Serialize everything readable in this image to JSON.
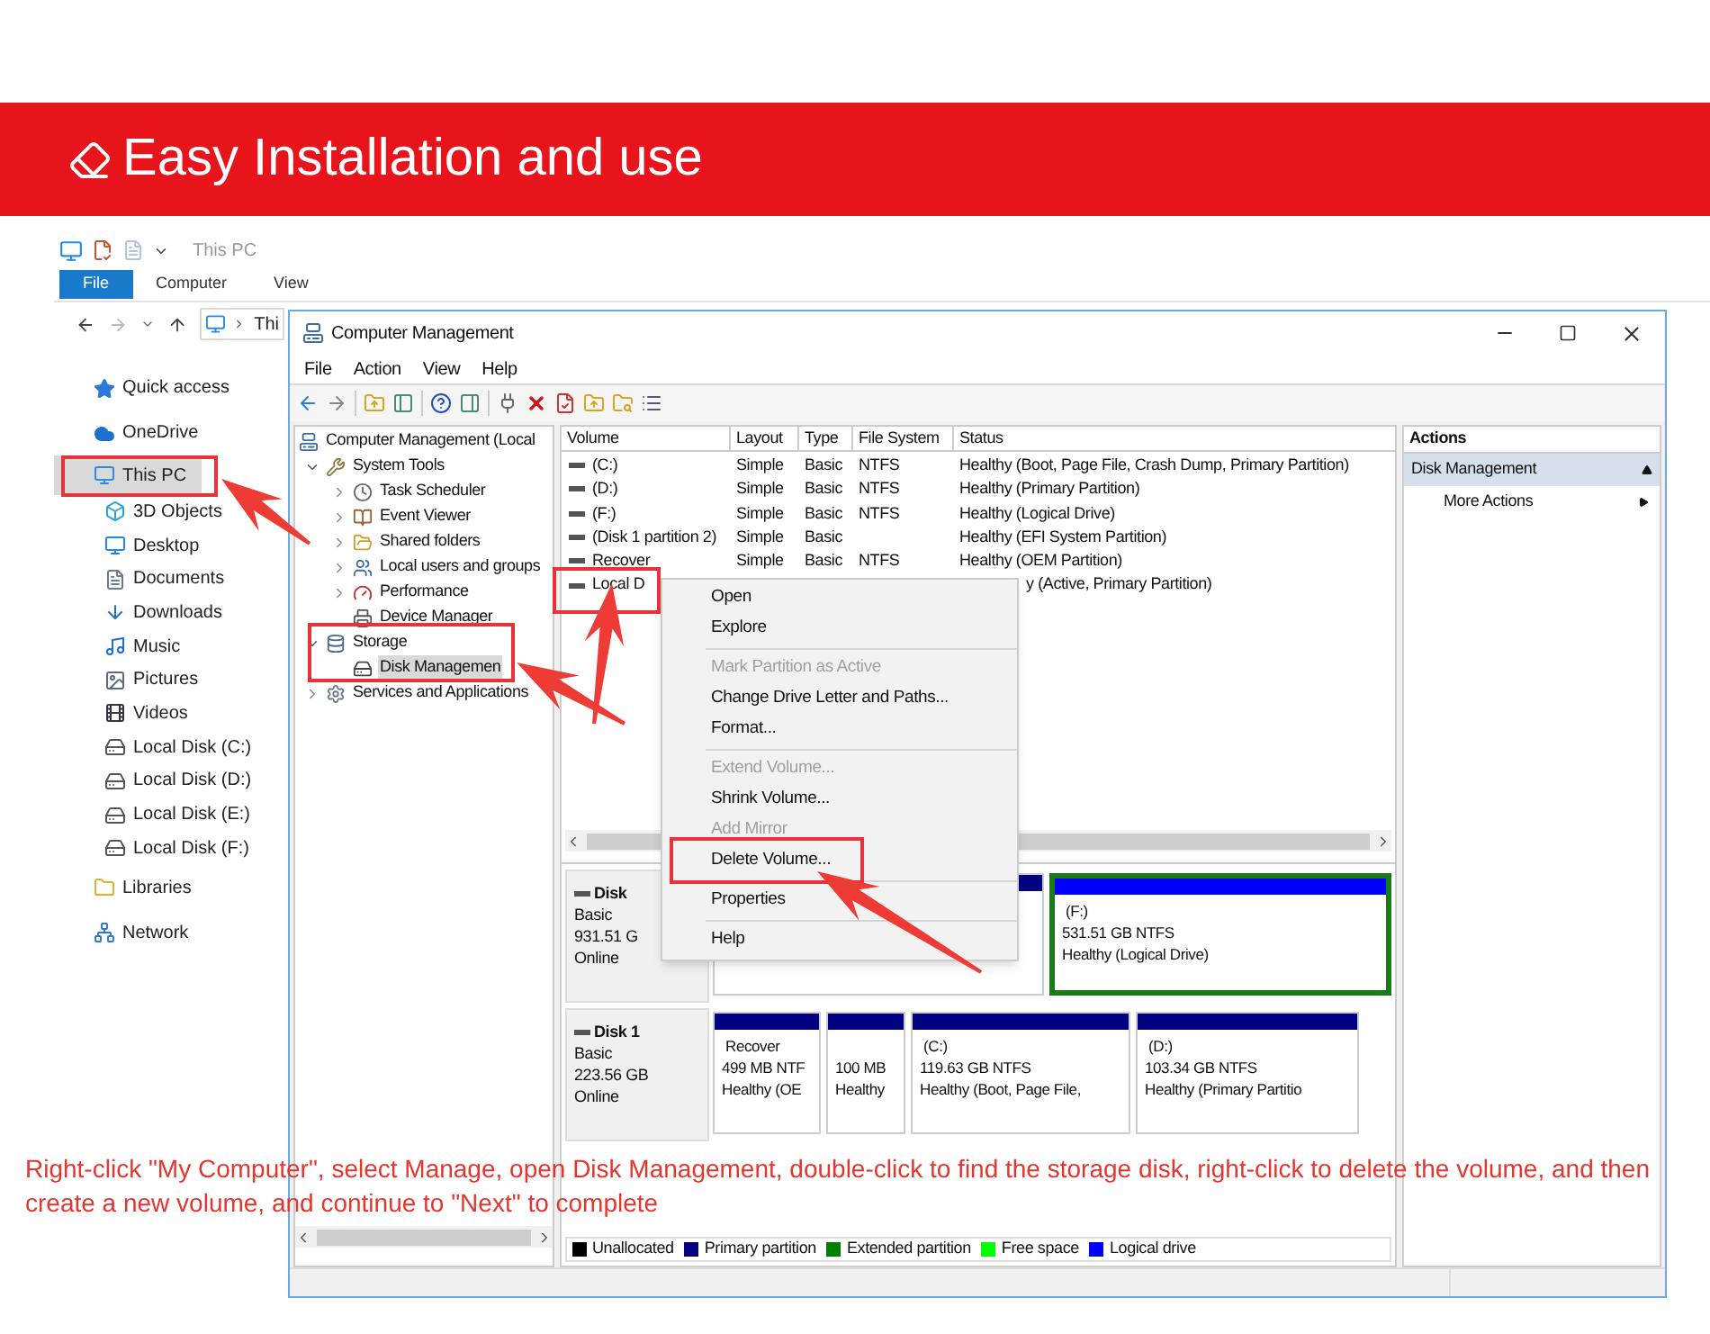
{
  "banner": {
    "title": "Easy Installation and use"
  },
  "explorer": {
    "title": "This PC",
    "ribbon_tabs": [
      {
        "label": "File",
        "selected": true
      },
      {
        "label": "Computer",
        "selected": false
      },
      {
        "label": "View",
        "selected": false
      }
    ],
    "address": "Thi",
    "nav": [
      {
        "label": "Quick access",
        "kind": "star",
        "selected": false
      },
      {
        "label": "OneDrive",
        "kind": "cloud",
        "selected": false
      },
      {
        "label": "This PC",
        "kind": "pc",
        "selected": true,
        "children": [
          {
            "label": "3D Objects",
            "kind": "cube",
            "selected": false
          },
          {
            "label": "Desktop",
            "kind": "desktop",
            "selected": false
          },
          {
            "label": "Documents",
            "kind": "document",
            "selected": false
          },
          {
            "label": "Downloads",
            "kind": "download",
            "selected": false
          },
          {
            "label": "Music",
            "kind": "music",
            "selected": false
          },
          {
            "label": "Pictures",
            "kind": "pictures",
            "selected": false
          },
          {
            "label": "Videos",
            "kind": "videos",
            "selected": false
          },
          {
            "label": "Local Disk (C:)",
            "kind": "disk",
            "selected": false
          },
          {
            "label": "Local Disk (D:)",
            "kind": "disk",
            "selected": false
          },
          {
            "label": "Local Disk (E:)",
            "kind": "disk",
            "selected": false
          },
          {
            "label": "Local Disk (F:)",
            "kind": "disk",
            "selected": false
          }
        ]
      },
      {
        "label": "Libraries",
        "kind": "library",
        "selected": false
      },
      {
        "label": "Network",
        "kind": "network",
        "selected": false
      }
    ]
  },
  "manager": {
    "title": "Computer Management",
    "menu": [
      "File",
      "Action",
      "View",
      "Help"
    ],
    "tree": [
      {
        "label": "Computer Management (Local",
        "kind": "computer",
        "selected": false,
        "children": [
          {
            "label": "System Tools",
            "kind": "tools",
            "expanded": true,
            "selected": false,
            "children": [
              {
                "label": "Task Scheduler",
                "kind": "clock",
                "expanded": false,
                "selected": false
              },
              {
                "label": "Event Viewer",
                "kind": "event",
                "expanded": false,
                "selected": false
              },
              {
                "label": "Shared folders",
                "kind": "shared",
                "expanded": false,
                "selected": false
              },
              {
                "label": "Local users and groups",
                "kind": "users",
                "expanded": false,
                "selected": false
              },
              {
                "label": "Performance",
                "kind": "performance",
                "expanded": false,
                "selected": false
              },
              {
                "label": "Device Manager",
                "kind": "device",
                "selected": false
              }
            ]
          },
          {
            "label": "Storage",
            "kind": "storage",
            "expanded": true,
            "selected": false,
            "children": [
              {
                "label": "Disk Managemen",
                "kind": "disk",
                "selected": true
              }
            ]
          },
          {
            "label": "Services and Applications",
            "kind": "services",
            "expanded": false,
            "selected": false
          }
        ]
      }
    ],
    "columns": [
      "Volume",
      "Layout",
      "Type",
      "File System",
      "Status"
    ],
    "rows": [
      {
        "volume": "(C:)",
        "layout": "Simple",
        "type": "Basic",
        "file_system": "NTFS",
        "status": "Healthy (Boot, Page File, Crash Dump, Primary Partition)"
      },
      {
        "volume": "(D:)",
        "layout": "Simple",
        "type": "Basic",
        "file_system": "NTFS",
        "status": "Healthy (Primary Partition)"
      },
      {
        "volume": "(F:)",
        "layout": "Simple",
        "type": "Basic",
        "file_system": "NTFS",
        "status": "Healthy (Logical Drive)"
      },
      {
        "volume": "(Disk 1 partition 2)",
        "layout": "Simple",
        "type": "Basic",
        "status": "Healthy (EFI System Partition)"
      },
      {
        "volume": "Recover",
        "layout": "Simple",
        "type": "Basic",
        "file_system": "NTFS",
        "status": "Healthy (OEM Partition)"
      },
      {
        "volume": "Local D",
        "status": "y (Active, Primary Partition)"
      }
    ],
    "context_menu": [
      {
        "kind": "item",
        "label": "Open",
        "disabled": false
      },
      {
        "kind": "item",
        "label": "Explore",
        "disabled": false
      },
      {
        "kind": "separator"
      },
      {
        "kind": "item",
        "label": "Mark Partition as Active",
        "disabled": true
      },
      {
        "kind": "item",
        "label": "Change Drive Letter and Paths...",
        "disabled": false
      },
      {
        "kind": "item",
        "label": "Format...",
        "disabled": false
      },
      {
        "kind": "separator"
      },
      {
        "kind": "item",
        "label": "Extend Volume...",
        "disabled": true
      },
      {
        "kind": "item",
        "label": "Shrink Volume...",
        "disabled": false
      },
      {
        "kind": "item",
        "label": "Add Mirror",
        "disabled": true
      },
      {
        "kind": "item",
        "label": "Delete Volume...",
        "disabled": false
      },
      {
        "kind": "separator"
      },
      {
        "kind": "item",
        "label": "Properties",
        "disabled": false
      },
      {
        "kind": "separator"
      },
      {
        "kind": "item",
        "label": "Help",
        "disabled": false
      }
    ],
    "disks": [
      {
        "name": "Disk",
        "type": "Basic",
        "size": "931.51 G",
        "status": "Online",
        "partitions": [
          {
            "color": "#000080",
            "extended": false
          },
          {
            "color": "#0000ff",
            "extended": true,
            "name": "(F:)",
            "size": "531.51 GB NTFS",
            "health": "Healthy (Logical Drive)"
          }
        ]
      },
      {
        "name": "Disk 1",
        "type": "Basic",
        "size": "223.56 GB",
        "status": "Online",
        "partitions": [
          {
            "color": "#000080",
            "extended": false,
            "name": "Recover",
            "size": "499 MB NTF",
            "health": "Healthy (OE"
          },
          {
            "color": "#000080",
            "extended": false,
            "size": "100 MB",
            "health": "Healthy"
          },
          {
            "color": "#000080",
            "extended": false,
            "name": "(C:)",
            "size": "119.63 GB NTFS",
            "health": "Healthy (Boot, Page File,"
          },
          {
            "color": "#000080",
            "extended": false,
            "name": "(D:)",
            "size": "103.34 GB NTFS",
            "health": "Healthy (Primary Partitio"
          }
        ]
      }
    ],
    "legend": [
      {
        "label": "Unallocated",
        "color": "#000000"
      },
      {
        "label": "Primary partition",
        "color": "#000080"
      },
      {
        "label": "Extended partition",
        "color": "#008000"
      },
      {
        "label": "Free space",
        "color": "#00ff00"
      },
      {
        "label": "Logical drive",
        "color": "#0000ff"
      }
    ],
    "actions": {
      "title": "Actions",
      "section": "Disk Management",
      "expanded": true,
      "items": [
        "More Actions"
      ]
    }
  },
  "caption": "Right-click \"My Computer\", select Manage, open Disk Management, double-click to find the storage disk, right-click to delete the volume, and then create a new volume, and continue to \"Next\" to complete"
}
